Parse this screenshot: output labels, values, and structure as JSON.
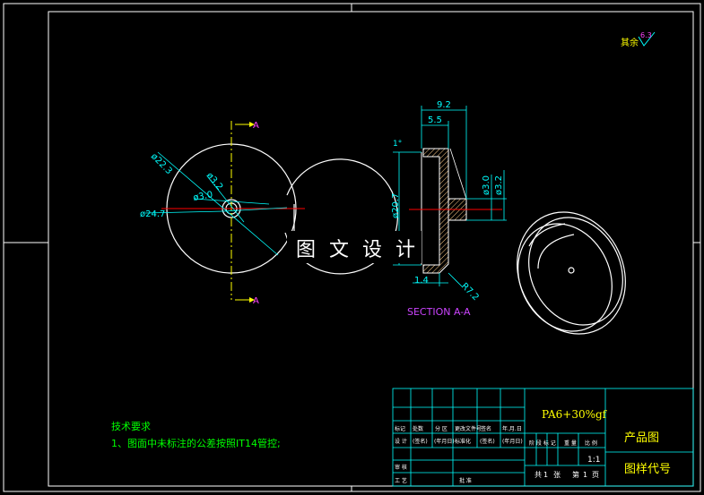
{
  "surface_finish": {
    "label": "其余",
    "value": "6.3"
  },
  "front_view": {
    "section_marks": [
      "A",
      "A"
    ],
    "dims": [
      "ø22.3",
      "ø3.2",
      "ø3.0",
      "ø24.7"
    ]
  },
  "section_view": {
    "title": "SECTION A-A",
    "dims": [
      "9.2",
      "5.5",
      "1°",
      "ø20.7",
      "ø3.0",
      "ø3.2",
      "1.4",
      "R7.2"
    ]
  },
  "watermark": "图 文 设 计",
  "tech_req": {
    "heading": "技术要求",
    "item1": "1、图面中未标注的公差按照IT14管控;"
  },
  "title_block": {
    "material": "PA6+30%gf",
    "drawing_name": "产品图",
    "drawing_code": "图样代号",
    "scale": "1:1",
    "row_labels": [
      "标记",
      "处数",
      "分 区",
      "更改文件号",
      "签名",
      "年.月.日"
    ],
    "row2_labels": [
      "设 计",
      "(签名)",
      "(年月日)",
      "标准化",
      "(签名)",
      "(年月日)"
    ],
    "stage_labels": [
      "阶 段 标 记",
      "重 量",
      "比 例"
    ],
    "review_label": "审 核",
    "process_label": "工 艺",
    "approve_label": "批 准",
    "sheets": [
      "共",
      "1",
      "张",
      "第",
      "1",
      "页"
    ]
  },
  "colors": {
    "background": "#000000",
    "frame": "#ffffff",
    "geometry": "#ffffff",
    "dimension": "#00ffff",
    "centerline": "#ffff00",
    "section_line": "#ff0000",
    "tech_text": "#00ff00",
    "hatch": "#ffcc88",
    "section_label": "#cc44ff",
    "title_material": "#ffff00",
    "title_name": "#ffff00"
  }
}
